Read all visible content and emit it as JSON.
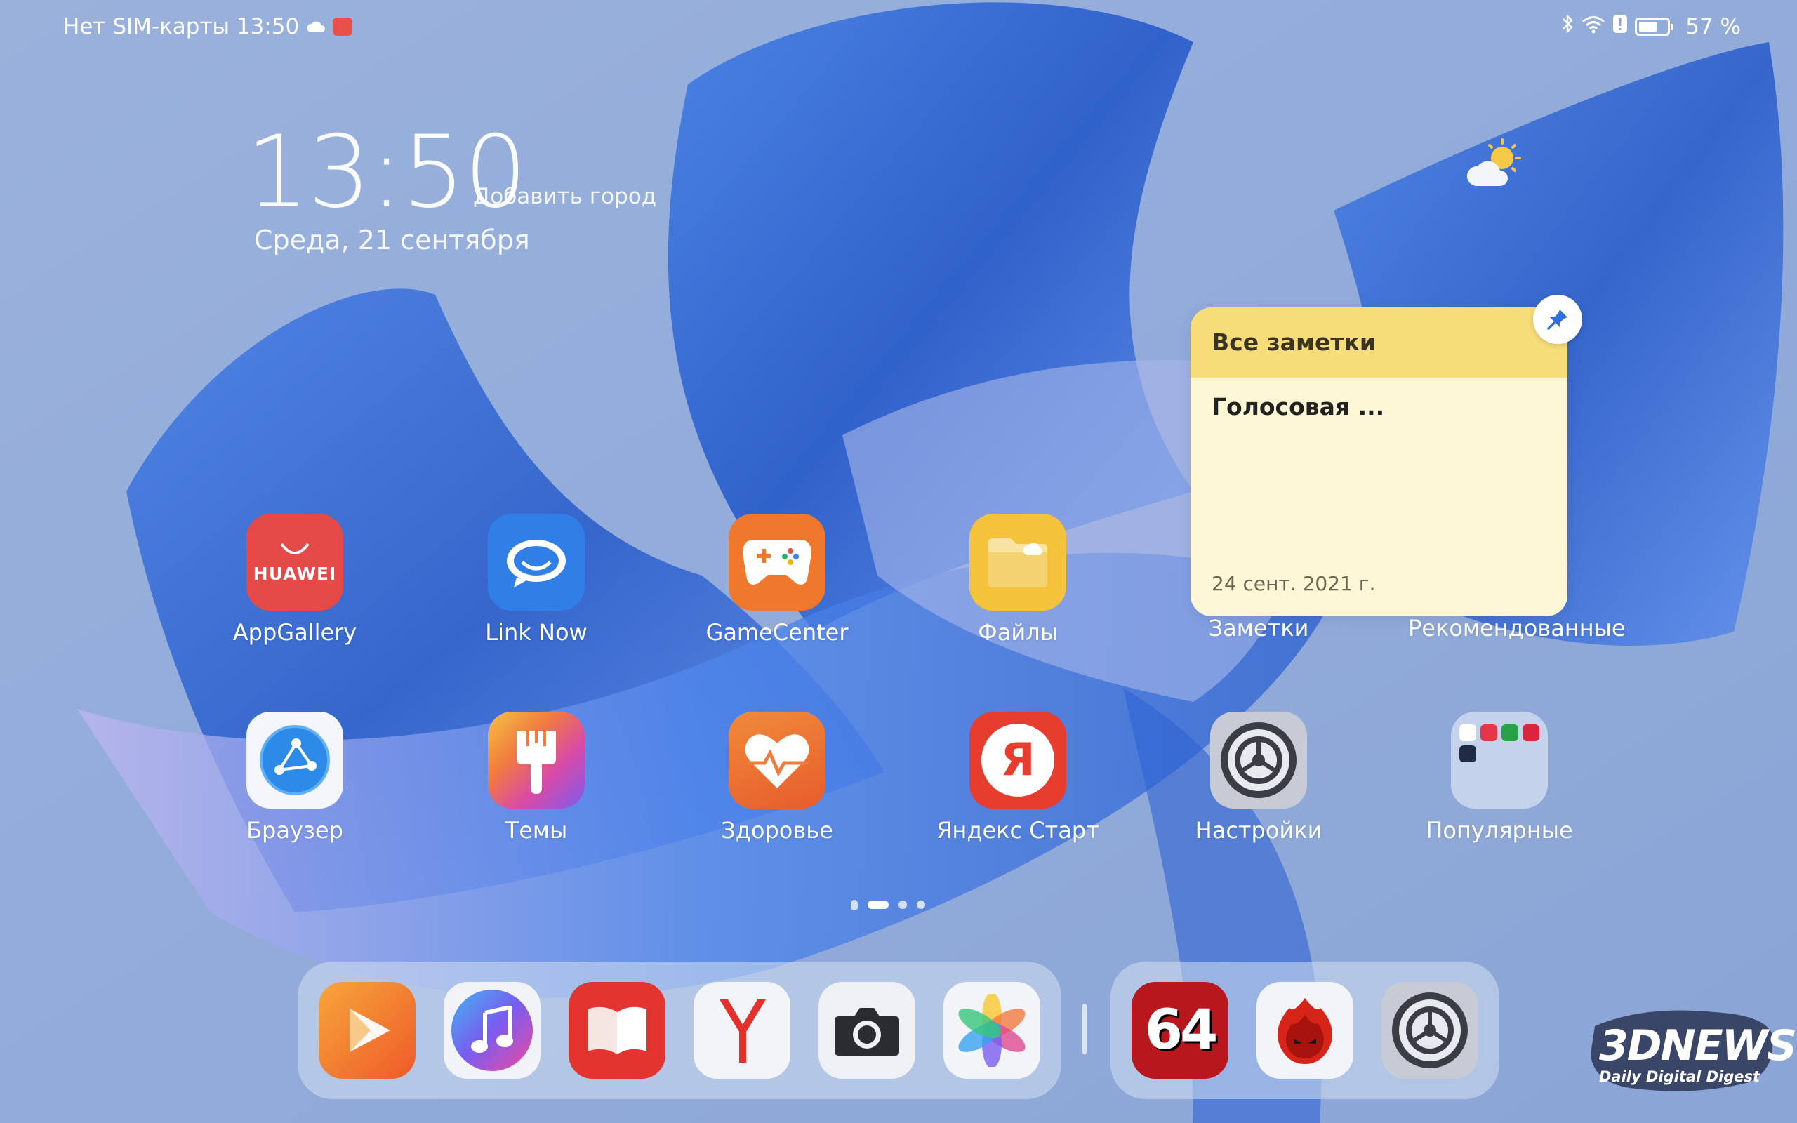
{
  "status_bar": {
    "carrier_time": "Нет SIM-карты 13:50",
    "battery_percent": "57 %",
    "battery_level": 0.57
  },
  "clock_widget": {
    "time": "13:50",
    "add_city": "Добавить город",
    "date": "Среда, 21 сентября"
  },
  "note_widget": {
    "header": "Все заметки",
    "title": "Голосовая ...",
    "date": "24 сент. 2021 г."
  },
  "apps_row1": [
    {
      "label": "AppGallery",
      "icon": "appgallery-icon",
      "brand_text": "HUAWEI"
    },
    {
      "label": "Link Now",
      "icon": "link-now-icon"
    },
    {
      "label": "GameCenter",
      "icon": "gamecenter-icon"
    },
    {
      "label": "Файлы",
      "icon": "files-icon"
    },
    {
      "label": "Заметки",
      "icon": "notes-widget"
    },
    {
      "label": "Рекомендованные",
      "icon": "recommended-widget"
    }
  ],
  "apps_row2": [
    {
      "label": "Браузер",
      "icon": "browser-icon"
    },
    {
      "label": "Темы",
      "icon": "themes-icon"
    },
    {
      "label": "Здоровье",
      "icon": "health-icon"
    },
    {
      "label": "Яндекс Старт",
      "icon": "yandex-start-icon",
      "glyph": "Я"
    },
    {
      "label": "Настройки",
      "icon": "settings-icon"
    },
    {
      "label": "Популярные",
      "icon": "folder-icon"
    }
  ],
  "dock_left": [
    "video-icon",
    "music-icon",
    "books-icon",
    "yandex-browser-icon",
    "camera-icon",
    "gallery-icon"
  ],
  "dock_right": [
    {
      "icon": "aida64-icon",
      "glyph": "64"
    },
    {
      "icon": "antutu-icon"
    },
    {
      "icon": "settings-icon"
    }
  ],
  "watermark": {
    "logo": "3DNEWS",
    "tagline": "Daily Digital Digest"
  },
  "colors": {
    "appgallery": "#e34a48",
    "linknow": "#2f7fe6",
    "gamecenter": "#f0782d",
    "files": "#f5c23c",
    "note_header": "#f7dc7a",
    "note_body": "#fef7d6",
    "yandex_red": "#e63d2e",
    "aida_red": "#b8171e"
  }
}
